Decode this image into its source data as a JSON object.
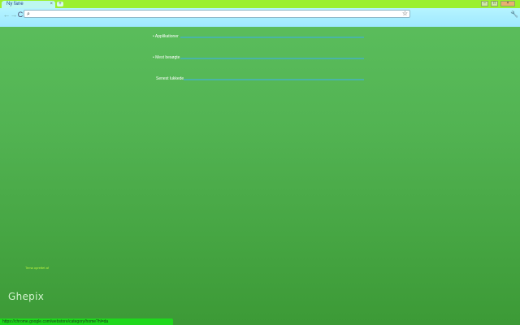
{
  "tab": {
    "title": "Ny fane",
    "close_glyph": "×",
    "new_tab_glyph": "+"
  },
  "window": {
    "minimize_glyph": "–",
    "maximize_glyph": "□",
    "close_glyph": "×"
  },
  "toolbar": {
    "back_glyph": "←",
    "forward_glyph": "→",
    "reload_glyph": "C",
    "search_glyph": "⌕",
    "address_value": "",
    "star_glyph": "☆",
    "wrench_glyph": "🔧"
  },
  "sections": [
    {
      "label": "• Applikationer"
    },
    {
      "label": "• Mest besøgte"
    },
    {
      "label": "Senest lukkede"
    }
  ],
  "theme_info": "Tema oprettet af",
  "logo": "Ghepix",
  "status": {
    "url": "https://chrome.google.com/webstore/category/home?hl=da"
  },
  "colors": {
    "tabstrip": "#9bf02e",
    "toolbar": "#9fe8ff",
    "background_top": "#5cbf5e",
    "background_bottom": "#3c9a36",
    "section_line": "#4ab4a6",
    "statusbar": "#1fd81c"
  }
}
